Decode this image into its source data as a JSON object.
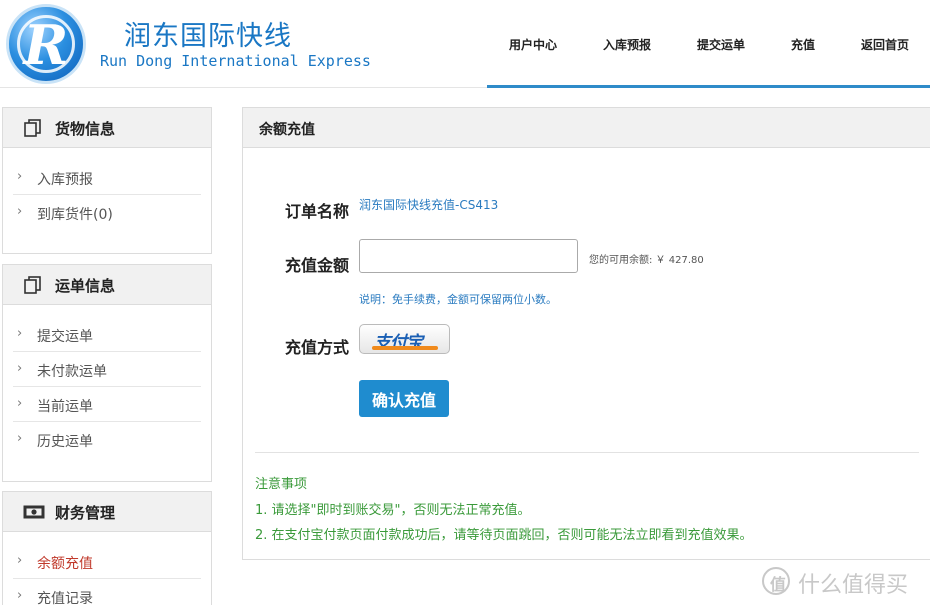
{
  "brand": {
    "logo_letter": "R",
    "name_cn": "润东国际快线",
    "name_en": "Run Dong International Express"
  },
  "nav": {
    "items": [
      {
        "label": "用户中心"
      },
      {
        "label": "入库预报"
      },
      {
        "label": "提交运单"
      },
      {
        "label": "充值"
      },
      {
        "label": "返回首页"
      }
    ]
  },
  "sidebar": {
    "sections": [
      {
        "title": "货物信息",
        "icon": "copy-icon",
        "items": [
          {
            "label": "入库预报"
          },
          {
            "label": "到库货件(0)"
          }
        ]
      },
      {
        "title": "运单信息",
        "icon": "copy-icon",
        "items": [
          {
            "label": "提交运单"
          },
          {
            "label": "未付款运单"
          },
          {
            "label": "当前运单"
          },
          {
            "label": "历史运单"
          }
        ]
      },
      {
        "title": "财务管理",
        "icon": "money-icon",
        "items": [
          {
            "label": "余额充值",
            "active": true
          },
          {
            "label": "充值记录"
          }
        ]
      }
    ]
  },
  "main": {
    "title": "余额充值",
    "form": {
      "order_name_label": "订单名称",
      "order_name_value": "润东国际快线充值-CS413",
      "amount_label": "充值金额",
      "amount_value": "",
      "balance_text": "您的可用余额: ￥ 427.80",
      "amount_note": "说明：免手续费，金额可保留两位小数。",
      "method_label": "充值方式",
      "method_option": "支付宝",
      "confirm_label": "确认充值"
    },
    "notice": {
      "title": "注意事项",
      "lines": [
        "1. 请选择\"即时到账交易\"，否则无法正常充值。",
        "2. 在支付宝付款页面付款成功后，请等待页面跳回，否则可能无法立即看到充值效果。"
      ]
    }
  },
  "watermark": {
    "icon_glyph": "值",
    "text": "什么值得买"
  },
  "colors": {
    "accent": "#1f8ccf",
    "link": "#2a7bc0",
    "notice": "#3a9a3a",
    "active": "#c0392b"
  }
}
